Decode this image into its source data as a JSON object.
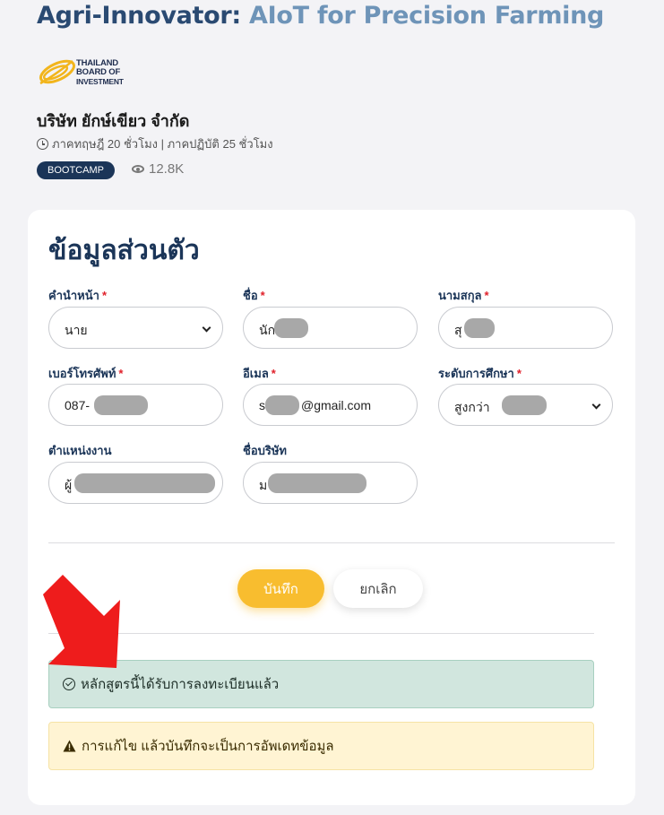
{
  "course": {
    "title_main": "Agri-Innovator: ",
    "title_accent": "AIoT for Precision Farming"
  },
  "logo": {
    "line1": "THAILAND",
    "line2": "BOARD OF",
    "line3": "INVESTMENT"
  },
  "company": "บริษัท ยักษ์เขียว จำกัด",
  "hours": "ภาคทฤษฎี 20 ชั่วโมง | ภาคปฏิบัติ 25 ชั่วโมง",
  "badge": "BOOTCAMP",
  "views": "12.8K",
  "form": {
    "section_title": "ข้อมูลส่วนตัว",
    "required_mark": "*",
    "fields": {
      "prefix": {
        "label": "คำนำหน้า",
        "value": "นาย"
      },
      "first_name": {
        "label": "ชื่อ",
        "value": "นัก"
      },
      "last_name": {
        "label": "นามสกุล",
        "value": "สุ"
      },
      "phone": {
        "label": "เบอร์โทรศัพท์",
        "value": "087-"
      },
      "email": {
        "label": "อีเมล",
        "value_prefix": "s",
        "value_suffix": "@gmail.com"
      },
      "education": {
        "label": "ระดับการศึกษา",
        "value": "สูงกว่า"
      },
      "position": {
        "label": "ตำแหน่งงาน",
        "value": "ผู้"
      },
      "company": {
        "label": "ชื่อบริษัท",
        "value": "ม"
      }
    },
    "save_label": "บันทึก",
    "cancel_label": "ยกเลิก"
  },
  "alerts": {
    "success": "หลักสูตรนี้ได้รับการลงทะเบียนแล้ว",
    "warning": "การแก้ไข แล้วบันทึกจะเป็นการอัพเดทข้อมูล"
  },
  "colors": {
    "primary": "#1b3558",
    "accent": "#6e94b8",
    "save": "#f8bd2f",
    "success_bg": "#d1e6de",
    "warning_bg": "#fff4d3",
    "annotation_arrow": "#ee1c1c"
  }
}
